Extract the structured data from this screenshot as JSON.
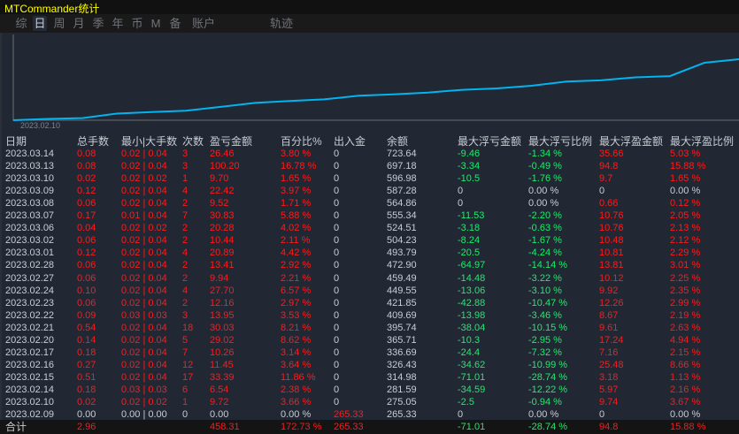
{
  "window": {
    "title": "MTCommander统计"
  },
  "tabs": [
    {
      "label": "综",
      "selected": false
    },
    {
      "label": "日",
      "selected": true
    },
    {
      "label": "周",
      "selected": false
    },
    {
      "label": "月",
      "selected": false
    },
    {
      "label": "季",
      "selected": false
    },
    {
      "label": "年",
      "selected": false
    },
    {
      "label": "币",
      "selected": false
    },
    {
      "label": "M",
      "selected": false
    },
    {
      "label": "备",
      "selected": false
    },
    {
      "label": "账户",
      "selected": false
    },
    {
      "label": "轨迹",
      "selected": false
    }
  ],
  "colors": {
    "line": "#00b4f0",
    "positive": "#ff1a1a",
    "negative": "#1aee6a",
    "neutral": "#c8ccd4"
  },
  "chart_data": {
    "type": "line",
    "x_label_start": "2023.02.10",
    "x": [
      "2023.02.09",
      "2023.02.10",
      "2023.02.14",
      "2023.02.15",
      "2023.02.16",
      "2023.02.17",
      "2023.02.20",
      "2023.02.21",
      "2023.02.22",
      "2023.02.23",
      "2023.02.24",
      "2023.02.27",
      "2023.02.28",
      "2023.03.01",
      "2023.03.02",
      "2023.03.06",
      "2023.03.07",
      "2023.03.08",
      "2023.03.09",
      "2023.03.10",
      "2023.03.13",
      "2023.03.14"
    ],
    "y": [
      265.33,
      275.05,
      281.59,
      314.98,
      326.43,
      336.69,
      365.71,
      395.74,
      409.69,
      421.85,
      449.55,
      459.49,
      472.9,
      493.79,
      504.23,
      524.51,
      555.34,
      564.86,
      587.28,
      596.98,
      697.18,
      723.64
    ]
  },
  "table": {
    "headers": [
      "日期",
      "总手数",
      "最小|大手数",
      "次数",
      "盈亏金额",
      "百分比%",
      "出入金",
      "余额",
      "最大浮亏金额",
      "最大浮亏比例",
      "最大浮盈金额",
      "最大浮盈比例"
    ],
    "rows": [
      [
        "2023.03.14",
        "0.08",
        "0.02 | 0.04",
        "3",
        "26.46",
        "3.80 %",
        "0",
        "723.64",
        "-9.46",
        "-1.34 %",
        "35.66",
        "5.03 %"
      ],
      [
        "2023.03.13",
        "0.08",
        "0.02 | 0.04",
        "3",
        "100.20",
        "16.78 %",
        "0",
        "697.18",
        "-3.34",
        "-0.49 %",
        "94.8",
        "15.88 %"
      ],
      [
        "2023.03.10",
        "0.02",
        "0.02 | 0.02",
        "1",
        "9.70",
        "1.65 %",
        "0",
        "596.98",
        "-10.5",
        "-1.76 %",
        "9.7",
        "1.65 %"
      ],
      [
        "2023.03.09",
        "0.12",
        "0.02 | 0.04",
        "4",
        "22.42",
        "3.97 %",
        "0",
        "587.28",
        "0",
        "0.00 %",
        "0",
        "0.00 %"
      ],
      [
        "2023.03.08",
        "0.06",
        "0.02 | 0.04",
        "2",
        "9.52",
        "1.71 %",
        "0",
        "564.86",
        "0",
        "0.00 %",
        "0.66",
        "0.12 %"
      ],
      [
        "2023.03.07",
        "0.17",
        "0.01 | 0.04",
        "7",
        "30.83",
        "5.88 %",
        "0",
        "555.34",
        "-11.53",
        "-2.20 %",
        "10.76",
        "2.05 %"
      ],
      [
        "2023.03.06",
        "0.04",
        "0.02 | 0.02",
        "2",
        "20.28",
        "4.02 %",
        "0",
        "524.51",
        "-3.18",
        "-0.63 %",
        "10.76",
        "2.13 %"
      ],
      [
        "2023.03.02",
        "0.06",
        "0.02 | 0.04",
        "2",
        "10.44",
        "2.11 %",
        "0",
        "504.23",
        "-8.24",
        "-1.67 %",
        "10.48",
        "2.12 %"
      ],
      [
        "2023.03.01",
        "0.12",
        "0.02 | 0.04",
        "4",
        "20.89",
        "4.42 %",
        "0",
        "493.79",
        "-20.5",
        "-4.24 %",
        "10.81",
        "2.29 %"
      ],
      [
        "2023.02.28",
        "0.06",
        "0.02 | 0.04",
        "2",
        "13.41",
        "2.92 %",
        "0",
        "472.90",
        "-64.97",
        "-14.14 %",
        "13.81",
        "3.01 %"
      ],
      [
        "2023.02.27",
        "0.06",
        "0.02 | 0.04",
        "2",
        "9.94",
        "2.21 %",
        "0",
        "459.49",
        "-14.48",
        "-3.22 %",
        "10.12",
        "2.25 %"
      ],
      [
        "2023.02.24",
        "0.10",
        "0.02 | 0.04",
        "4",
        "27.70",
        "6.57 %",
        "0",
        "449.55",
        "-13.06",
        "-3.10 %",
        "9.92",
        "2.35 %"
      ],
      [
        "2023.02.23",
        "0.06",
        "0.02 | 0.04",
        "2",
        "12.16",
        "2.97 %",
        "0",
        "421.85",
        "-42.88",
        "-10.47 %",
        "12.26",
        "2.99 %"
      ],
      [
        "2023.02.22",
        "0.09",
        "0.03 | 0.03",
        "3",
        "13.95",
        "3.53 %",
        "0",
        "409.69",
        "-13.98",
        "-3.46 %",
        "8.67",
        "2.19 %"
      ],
      [
        "2023.02.21",
        "0.54",
        "0.02 | 0.04",
        "18",
        "30.03",
        "8.21 %",
        "0",
        "395.74",
        "-38.04",
        "-10.15 %",
        "9.61",
        "2.63 %"
      ],
      [
        "2023.02.20",
        "0.14",
        "0.02 | 0.04",
        "5",
        "29.02",
        "8.62 %",
        "0",
        "365.71",
        "-10.3",
        "-2.95 %",
        "17.24",
        "4.94 %"
      ],
      [
        "2023.02.17",
        "0.18",
        "0.02 | 0.04",
        "7",
        "10.26",
        "3.14 %",
        "0",
        "336.69",
        "-24.4",
        "-7.32 %",
        "7.16",
        "2.15 %"
      ],
      [
        "2023.02.16",
        "0.27",
        "0.02 | 0.04",
        "12",
        "11.45",
        "3.64 %",
        "0",
        "326.43",
        "-34.62",
        "-10.99 %",
        "25.48",
        "8.66 %"
      ],
      [
        "2023.02.15",
        "0.51",
        "0.02 | 0.04",
        "17",
        "33.39",
        "11.86 %",
        "0",
        "314.98",
        "-71.01",
        "-28.74 %",
        "3.18",
        "1.13 %"
      ],
      [
        "2023.02.14",
        "0.18",
        "0.03 | 0.03",
        "6",
        "6.54",
        "2.38 %",
        "0",
        "281.59",
        "-34.59",
        "-12.22 %",
        "5.97",
        "2.16 %"
      ],
      [
        "2023.02.10",
        "0.02",
        "0.02 | 0.02",
        "1",
        "9.72",
        "3.66 %",
        "0",
        "275.05",
        "-2.5",
        "-0.94 %",
        "9.74",
        "3.67 %"
      ],
      [
        "2023.02.09",
        "0.00",
        "0.00 | 0.00",
        "0",
        "0.00",
        "0.00 %",
        "265.33",
        "265.33",
        "0",
        "0.00 %",
        "0",
        "0.00 %"
      ]
    ],
    "total": [
      "合计",
      "2.96",
      "",
      "",
      "458.31",
      "172.73 %",
      "265.33",
      "",
      "-71.01",
      "-28.74 %",
      "94.8",
      "15.88 %"
    ]
  }
}
